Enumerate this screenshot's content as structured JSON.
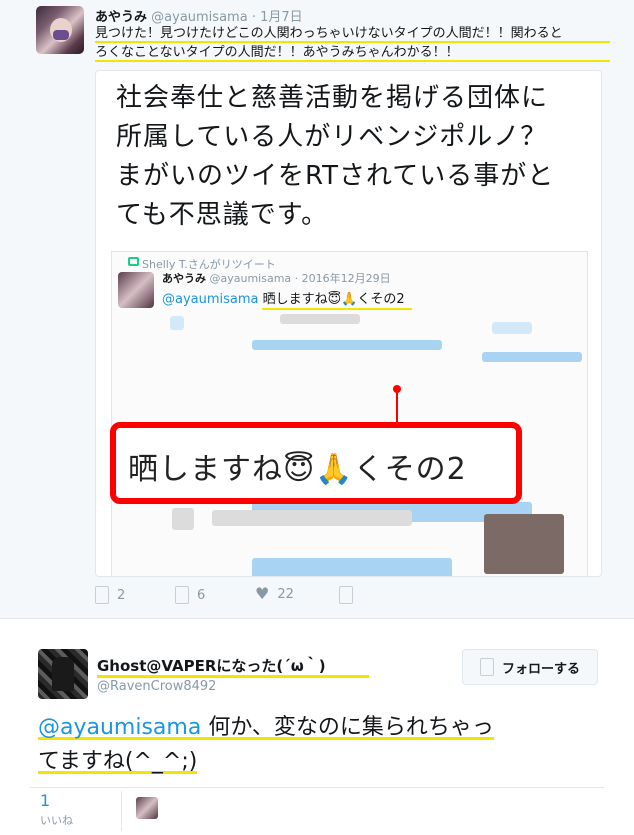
{
  "tweet": {
    "display_name": "あやうみ",
    "handle": "@ayaumisama",
    "dot": "·",
    "date": "1月7日",
    "text_line1": "見つけた！見つけたけどこの人関わっちゃいけないタイプの人間だ！！関わると",
    "text_line2": "ろくなことないタイプの人間だ！！あやうみちゃんわかる！！",
    "card": {
      "lines": [
        "社会奉仕と慈善活動を掲げる団体に",
        "所属している人がリベンジポルノ？",
        "まがいのツイをRTされている事がと",
        "ても不思議です。"
      ],
      "inner": {
        "retweet_label": "Shelly T.さんがリツイート",
        "name": "あやうみ",
        "handle_date": "@ayaumisama · 2016年12月29日",
        "mention": "@ayaumisama",
        "text": " 晒しますね😇🙏くその2"
      },
      "callout_text": "晒しますね😇🙏くその2"
    },
    "actions": {
      "reply_count": "2",
      "retweet_count": "6",
      "like_count": "22"
    },
    "icons": [
      "reply-icon",
      "retweet-icon",
      "heart-icon",
      "more-icon"
    ]
  },
  "reply": {
    "display_name": "Ghost@VAPERになった(´ω｀)",
    "handle": "@RavenCrow8492",
    "follow_label": "フォローする",
    "mention": "@ayaumisama",
    "text_line1_rest": " 何か、変なのに集られちゃっ",
    "text_line2": "てますね(^_^;)",
    "likes_count": "1",
    "likes_label": "いいね"
  },
  "colors": {
    "highlight": "#f2e600",
    "callout_border": "#ff0000",
    "link": "#1b95e0",
    "muted": "#8899a6"
  }
}
